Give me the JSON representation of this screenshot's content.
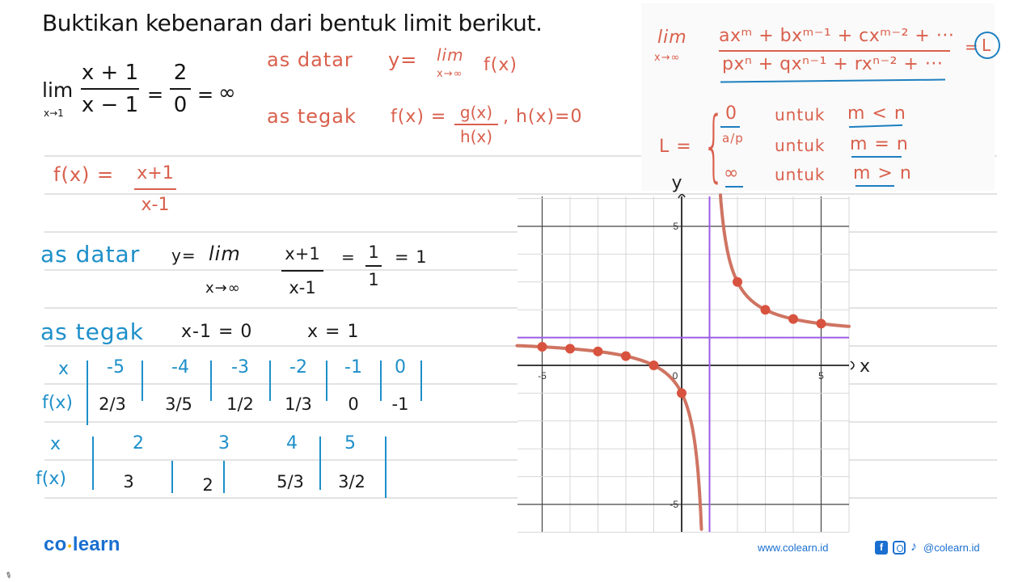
{
  "title": "Buktikan kebenaran dari bentuk limit berikut.",
  "problem": {
    "lim": "lim",
    "lim_sub": "x→1",
    "frac_num": "x + 1",
    "frac_den": "x − 1",
    "eq1": "=",
    "val_num": "2",
    "val_den": "0",
    "eq2": "=",
    "result": "∞"
  },
  "notes_red": {
    "as_datar": "as datar",
    "as_datar_y": "y=",
    "as_datar_lim": "lim",
    "as_datar_lim_sub": "x→∞",
    "as_datar_fx": "f(x)",
    "as_tegak": "as tegak",
    "as_tegak_fx": "f(x) =",
    "as_tegak_num": "g(x)",
    "as_tegak_den": "h(x)",
    "as_tegak_cond": ", h(x)=0"
  },
  "rule_box": {
    "lim": "lim",
    "lim_sub": "x→∞",
    "numerator": "axᵐ + bxᵐ⁻¹ + cxᵐ⁻² + ···",
    "denominator": "pxⁿ + qxⁿ⁻¹ + rxⁿ⁻² + ···",
    "equals": "=",
    "result": "L",
    "L_eq": "L =",
    "cases": [
      {
        "value": "0",
        "word": "untuk",
        "condition": "m < n"
      },
      {
        "value": "a/p",
        "word": "untuk",
        "condition": "m = n"
      },
      {
        "value": "∞",
        "word": "untuk",
        "condition": "m > n"
      }
    ]
  },
  "work": {
    "fx_label": "f(x) =",
    "fx_num": "x+1",
    "fx_den": "x-1",
    "as_datar": "as datar",
    "datar_y": "y=",
    "datar_lim": "lim",
    "datar_lim_sub": "x→∞",
    "datar_num": "x+1",
    "datar_den": "x-1",
    "datar_eq": "=",
    "datar_one_num": "1",
    "datar_one_den": "1",
    "datar_result": "= 1",
    "as_tegak": "as tegak",
    "tegak_eq1": "x-1 = 0",
    "tegak_eq2": "x = 1"
  },
  "table1": {
    "x_label": "x",
    "f_label": "f(x)",
    "x": [
      "-5",
      "-4",
      "-3",
      "-2",
      "-1",
      "0"
    ],
    "f": [
      "2/3",
      "3/5",
      "1/2",
      "1/3",
      "0",
      "-1"
    ]
  },
  "table2": {
    "x_label": "x",
    "f_label": "f(x)",
    "x": [
      "2",
      "3",
      "4",
      "5"
    ],
    "f": [
      "3",
      "2",
      "5/3",
      "3/2"
    ]
  },
  "chart_data": {
    "type": "line",
    "title": "",
    "xlabel": "x",
    "ylabel": "y",
    "xlim": [
      -5.9,
      6
    ],
    "ylim": [
      -6.1,
      6.1
    ],
    "x_ticks": [
      -5,
      0,
      5
    ],
    "y_ticks": [
      5,
      -5
    ],
    "x_tick_labels": [
      "-5",
      "0",
      "5"
    ],
    "y_tick_labels": [
      "5",
      "-5"
    ],
    "grid": true,
    "function": "f(x) = (x+1)/(x-1)",
    "asymptotes": {
      "horizontal_y": 1,
      "vertical_x": 1
    },
    "points": [
      {
        "x": -5,
        "y": 0.667
      },
      {
        "x": -4,
        "y": 0.6
      },
      {
        "x": -3,
        "y": 0.5
      },
      {
        "x": -2,
        "y": 0.333
      },
      {
        "x": -1,
        "y": 0
      },
      {
        "x": 0,
        "y": -1
      },
      {
        "x": 2,
        "y": 3
      },
      {
        "x": 3,
        "y": 2
      },
      {
        "x": 4,
        "y": 1.667
      },
      {
        "x": 5,
        "y": 1.5
      }
    ],
    "colors": {
      "curve": "#cf7462",
      "points": "#d8533f",
      "asymptote": "#9b5de5",
      "axis": "#222222",
      "grid": "#d7d7d7"
    }
  },
  "footer": {
    "logo_left": "co",
    "logo_dot": "•",
    "logo_right": "learn",
    "url": "www.colearn.id",
    "fb": "f",
    "tiktok": "♪",
    "handle": "@colearn.id"
  }
}
